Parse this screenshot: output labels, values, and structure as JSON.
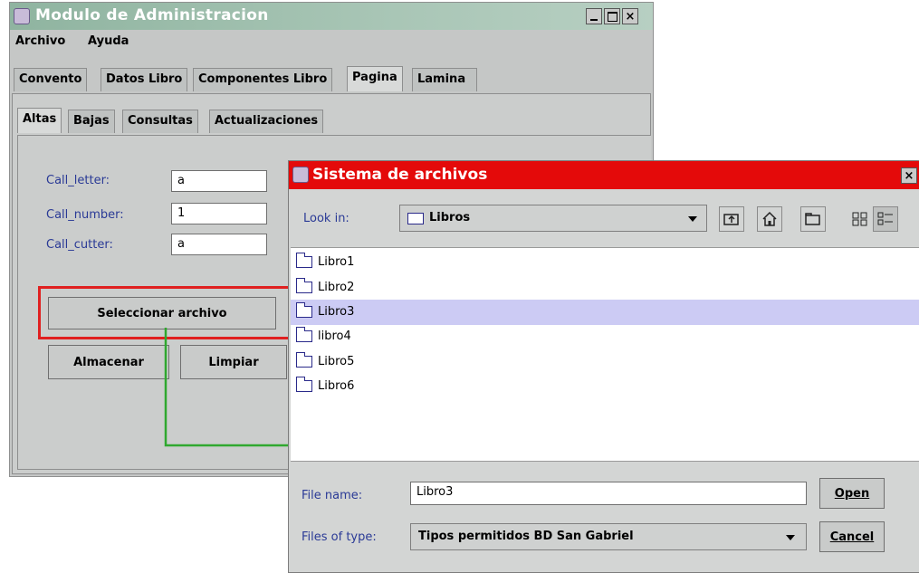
{
  "main_window": {
    "title": "Modulo de Administracion",
    "menu": [
      "Archivo",
      "Ayuda"
    ],
    "tabs": [
      "Convento",
      "Datos Libro",
      "Componentes Libro",
      "Pagina",
      "Lamina"
    ],
    "subtabs": [
      "Altas",
      "Bajas",
      "Consultas",
      "Actualizaciones"
    ],
    "fields": [
      {
        "label": "Call_letter:",
        "value": "a"
      },
      {
        "label": "Call_number:",
        "value": "1"
      },
      {
        "label": "Call_cutter:",
        "value": "a"
      }
    ],
    "select_file_button": "Seleccionar archivo",
    "store_button": "Almacenar",
    "clear_button": "Limpiar"
  },
  "dialog": {
    "title": "Sistema de archivos",
    "look_in_label": "Look in:",
    "look_in_value": "Libros",
    "files": [
      "Libro1",
      "Libro2",
      "Libro3",
      "libro4",
      "Libro5",
      "Libro6"
    ],
    "selected_file": "Libro3",
    "file_name_label": "File name:",
    "file_name_value": "Libro3",
    "files_of_type_label": "Files of type:",
    "files_of_type_value": "Tipos permitidos BD San Gabriel",
    "open_button": "Open",
    "cancel_button": "Cancel"
  },
  "annotation_colors": {
    "highlight_box": "#e02020",
    "arrow": "#2fa82f"
  }
}
